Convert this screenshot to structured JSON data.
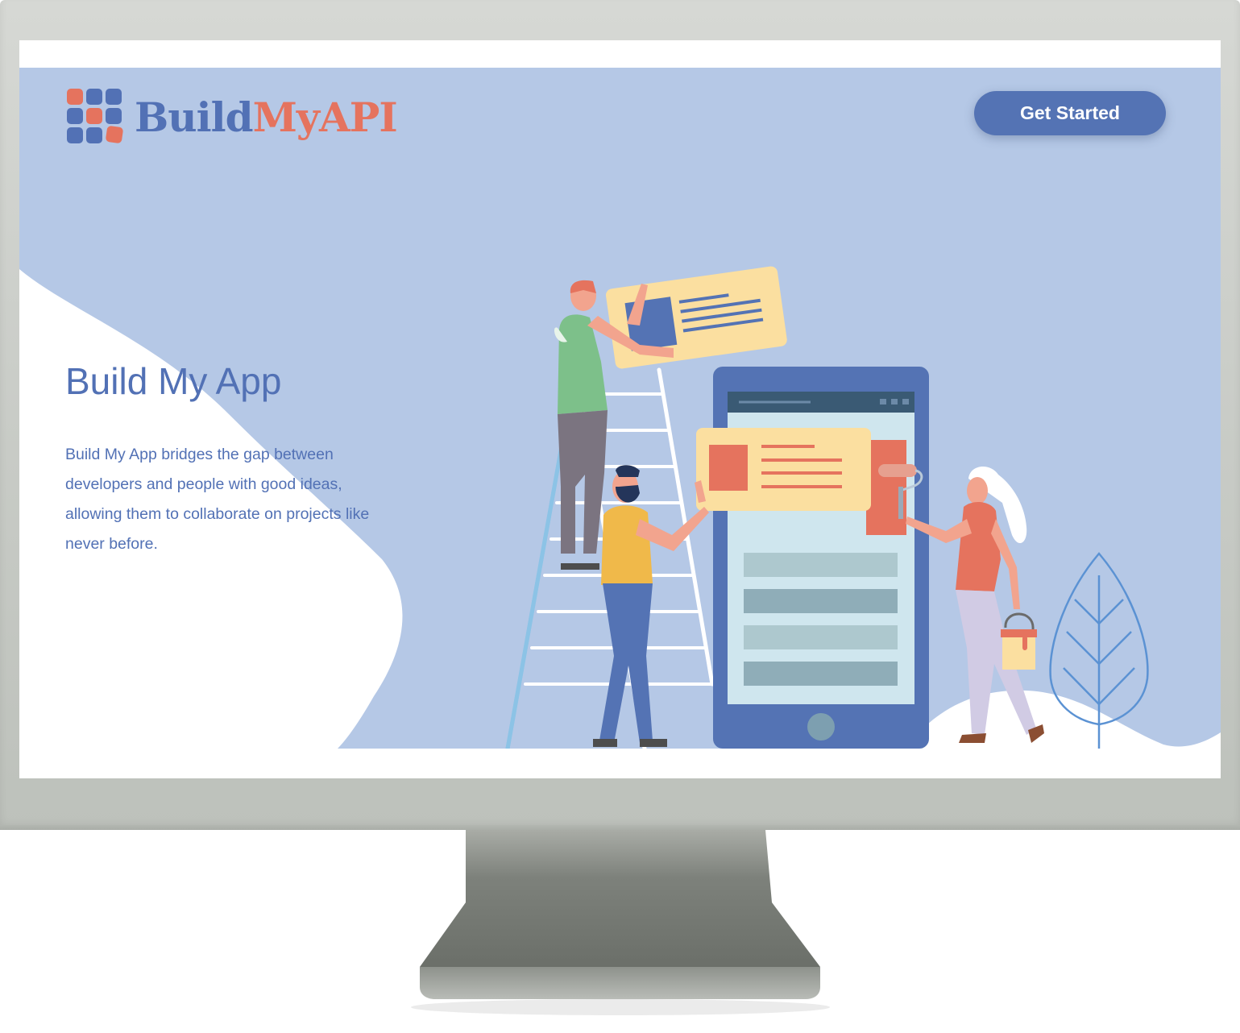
{
  "header": {
    "logo_build": "Build",
    "logo_myapi": "MyAPI",
    "cta_label": "Get Started"
  },
  "hero": {
    "title": "Build My App",
    "description": "Build My App bridges the gap between developers and people with good ideas, allowing them to collaborate on projects like never before."
  },
  "colors": {
    "brand_blue": "#5271b5",
    "brand_coral": "#e5735e",
    "hero_background": "#b5c8e6",
    "button": "#5473b4"
  },
  "icons": {
    "logo_mark": "grid-logo-icon",
    "illustration": "team-building-app-illustration"
  }
}
